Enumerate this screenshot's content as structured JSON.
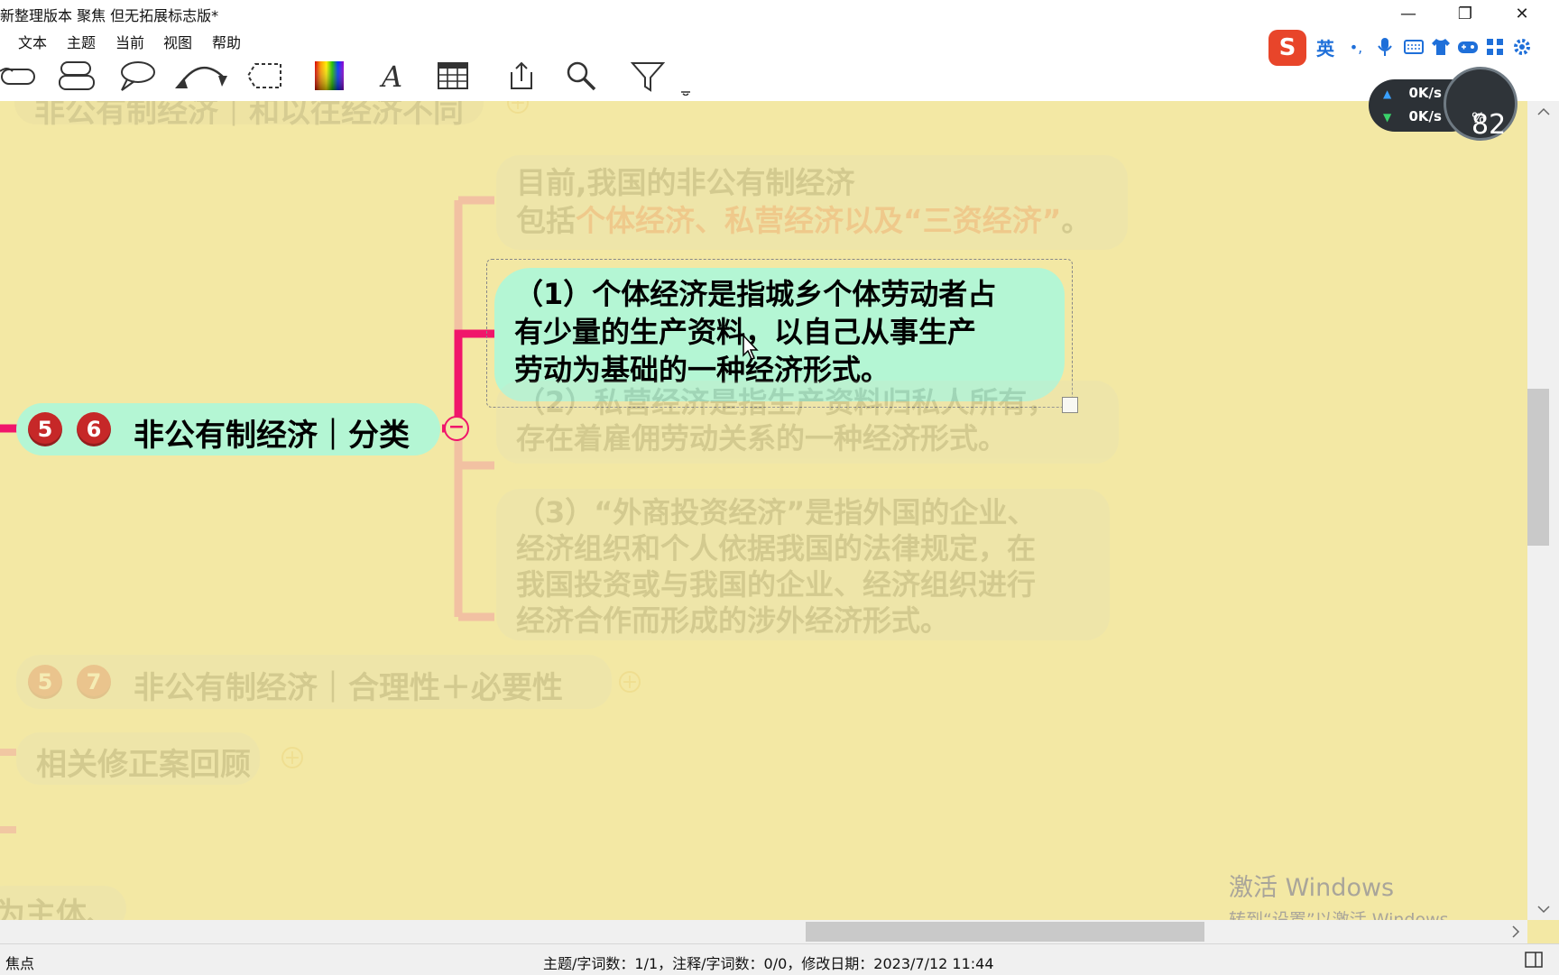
{
  "window": {
    "title": "新整理版本 聚焦 但无拓展标志版*",
    "minimize_glyph": "—",
    "restore_glyph": "❐",
    "close_glyph": "✕"
  },
  "menu": {
    "items": [
      "文本",
      "主题",
      "当前",
      "视图",
      "帮助"
    ]
  },
  "ime": {
    "logo": "S",
    "lang": "英",
    "punct": "•,"
  },
  "network": {
    "up": "0K/s",
    "down": "0K/s",
    "percent": "82",
    "percent_unit": "%"
  },
  "mindmap": {
    "top_faded_node": "非公有制经济｜和以往经济不同",
    "main_node": {
      "badges": [
        "5",
        "6"
      ],
      "label": "非公有制经济｜分类",
      "collapse_glyph": "−"
    },
    "children": [
      {
        "line1": "目前,我国的非公有制经济",
        "line2_prefix": "包括",
        "line2_highlight": "个体经济、私营经济以及“三资经济”",
        "line2_suffix": "。"
      },
      {
        "lines": [
          "（1）个体经济是指城乡个体劳动者占",
          "有少量的生产资料，以自己从事生产",
          "劳动为基础的一种经济形式。"
        ]
      },
      {
        "lines": [
          "（2）私营经济是指生产资料归私人所有，",
          "存在着雇佣劳动关系的一种经济形式。"
        ]
      },
      {
        "lines": [
          "（3）“外商投资经济”是指外国的企业、",
          "经济组织和个人依据我国的法律规定，在",
          "我国投资或与我国的企业、经济组织进行",
          "经济合作而形成的涉外经济形式。"
        ]
      }
    ],
    "sibling_57": {
      "badges": [
        "5",
        "7"
      ],
      "label": "非公有制经济｜合理性＋必要性"
    },
    "sibling_review": "相关修正案回顾",
    "bottom_left_text": "为主体、",
    "plus_glyph": "+"
  },
  "watermark": {
    "line1": "激活 Windows",
    "line2": "转到“设置”以激活 Windows。"
  },
  "status": {
    "mode": "焦点",
    "info": "主题/字词数：1/1，注释/字词数：0/0，修改日期：2023/7/12 11:44"
  },
  "colors": {
    "canvas_bg": "#f3e8a4",
    "branch_pink": "#f0166b",
    "node_mint": "#b4f6d4",
    "badge_red": "#c62828"
  }
}
